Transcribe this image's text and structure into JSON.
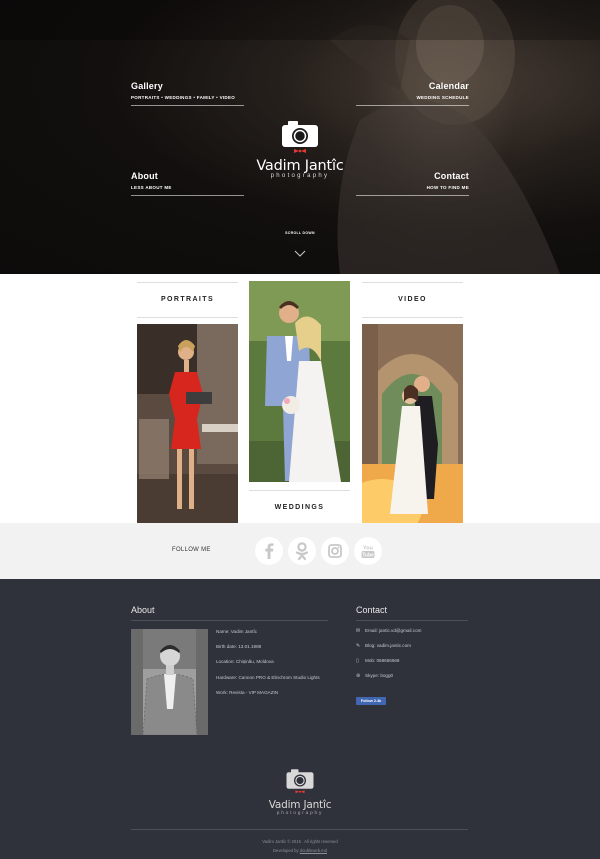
{
  "hero": {
    "nav": {
      "gallery": {
        "title": "Gallery",
        "sub": "PORTRAITS  •  WEDDINGS  •  FAMILY  •  VIDEO"
      },
      "about": {
        "title": "About",
        "sub": "LESS ABOUT ME"
      },
      "calendar": {
        "title": "Calendar",
        "sub": "WEDDING SCHEDULE"
      },
      "contact": {
        "title": "Contact",
        "sub": "HOW TO FIND ME"
      }
    },
    "logo": {
      "name": "Vadim Jantîc",
      "tagline": "photography"
    },
    "scroll_label": "SCROLL DOWN"
  },
  "gallery": {
    "portraits_label": "PORTRAITS",
    "weddings_label": "WEDDINGS",
    "video_label": "VIDEO"
  },
  "follow": {
    "label": "FOLLOW ME",
    "icons": [
      "facebook-icon",
      "odnoklassniki-icon",
      "instagram-icon",
      "youtube-icon"
    ],
    "youtube_text": "You\nTube"
  },
  "footer": {
    "about": {
      "heading": "About",
      "lines": [
        "Name: Vadim Jantîc",
        "Birth date: 13.01.1988",
        "Location: Chișinău, Moldova",
        "Hardware: Cannon PRO & Elinchrom Studio Lights",
        "Work: Revista - VIP MAGAZIN"
      ]
    },
    "contact": {
      "heading": "Contact",
      "email": "Email: jantic.vd@gmail.com",
      "blog": "Blog: vadim.jantic.com",
      "mob": "Mob: 068656669",
      "skype": "Skype: bogg0",
      "fb_follow": "Follow 2.4k"
    },
    "logo": {
      "name": "Vadim Jantîc",
      "tagline": "photography"
    },
    "copyright": "Vadim Jantîc © 2015 . All rights reserved",
    "developed_prefix": "Developed by",
    "developed_by": "doubleweb.md"
  },
  "colors": {
    "footer_bg": "#2f323a",
    "follow_bg": "#f2f2f2",
    "logo_red": "#e53935",
    "facebook_blue": "#4267b2"
  }
}
